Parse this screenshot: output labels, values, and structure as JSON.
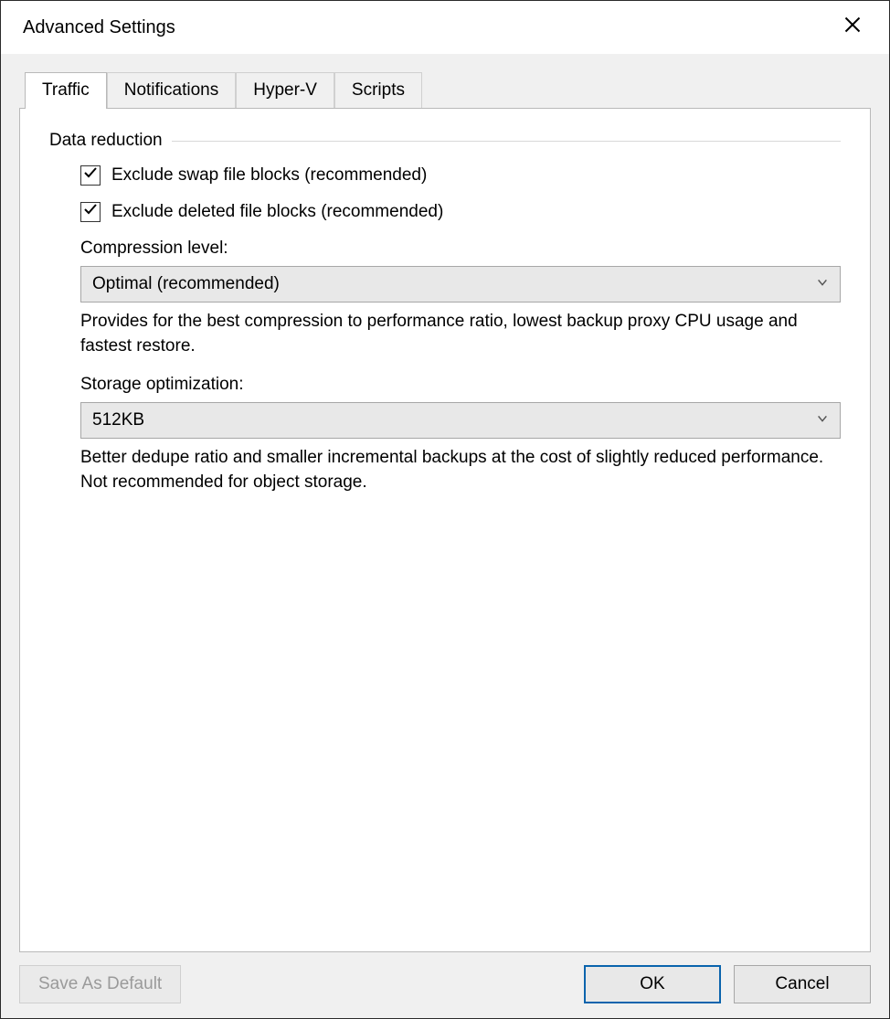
{
  "title": "Advanced Settings",
  "tabs": [
    {
      "label": "Traffic",
      "active": true
    },
    {
      "label": "Notifications",
      "active": false
    },
    {
      "label": "Hyper-V",
      "active": false
    },
    {
      "label": "Scripts",
      "active": false
    }
  ],
  "group": {
    "title": "Data reduction",
    "checkbox1_label": "Exclude swap file blocks (recommended)",
    "checkbox1_checked": true,
    "checkbox2_label": "Exclude deleted file blocks (recommended)",
    "checkbox2_checked": true,
    "compression_label": "Compression level:",
    "compression_value": "Optimal (recommended)",
    "compression_help": "Provides for the best compression to performance ratio, lowest backup proxy CPU usage and fastest restore.",
    "storage_label": "Storage optimization:",
    "storage_value": "512KB",
    "storage_help": "Better dedupe ratio and smaller incremental backups at the cost of slightly reduced performance. Not recommended for object storage."
  },
  "footer": {
    "save_default": "Save As Default",
    "ok": "OK",
    "cancel": "Cancel"
  }
}
